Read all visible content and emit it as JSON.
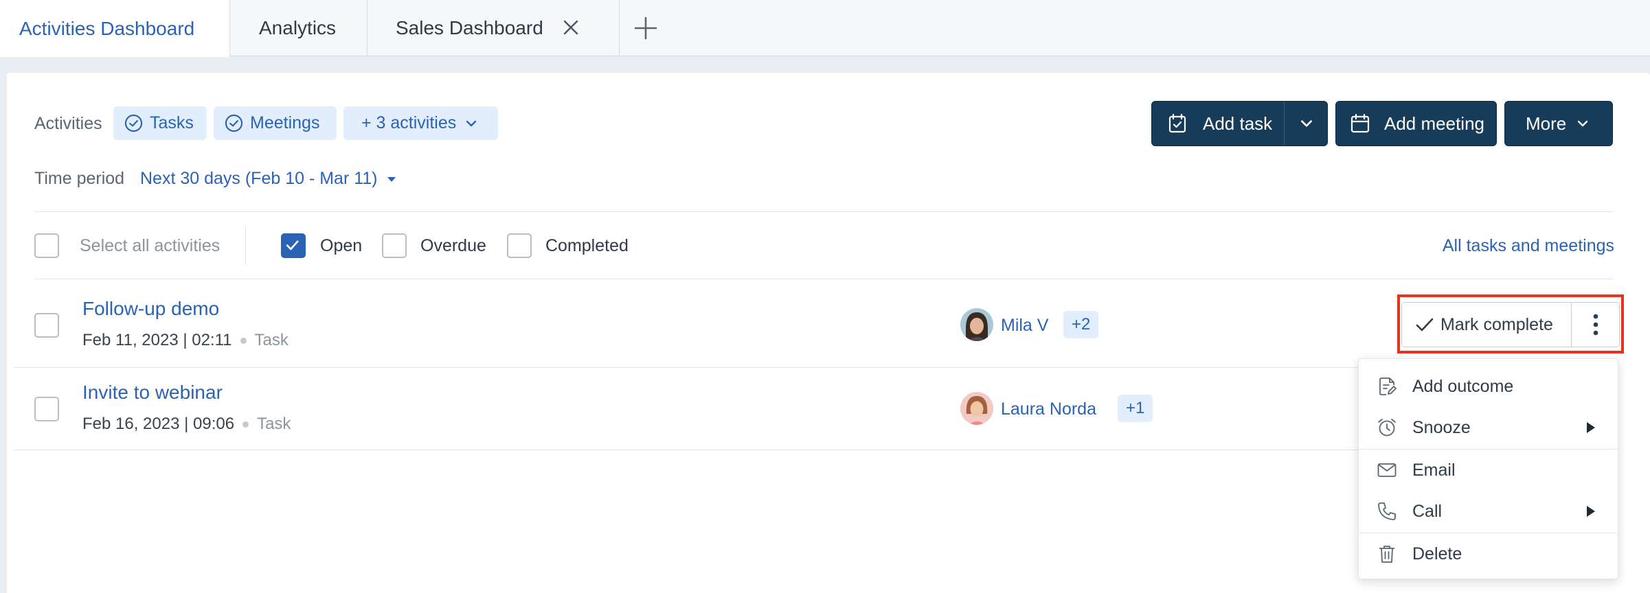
{
  "tabs": [
    {
      "label": "Activities Dashboard"
    },
    {
      "label": "Analytics"
    },
    {
      "label": "Sales Dashboard"
    }
  ],
  "filters": {
    "activities_label": "Activities",
    "chip_tasks": "Tasks",
    "chip_meetings": "Meetings",
    "chip_more": "+ 3 activities",
    "time_period_label": "Time period",
    "time_period_value": "Next 30 days (Feb 10 - Mar 11)"
  },
  "toolbar": {
    "add_task": "Add task",
    "add_meeting": "Add meeting",
    "more": "More"
  },
  "status_filters": {
    "select_all": "Select all activities",
    "open": "Open",
    "overdue": "Overdue",
    "completed": "Completed",
    "all_link": "All tasks and meetings"
  },
  "activities": [
    {
      "title": "Follow-up demo",
      "datetime": "Feb 11, 2023 | 02:11",
      "type": "Task",
      "person": "Mila V",
      "extra": "+2"
    },
    {
      "title": "Invite to webinar",
      "datetime": "Feb 16, 2023 | 09:06",
      "type": "Task",
      "person": "Laura Norda",
      "extra": "+1"
    }
  ],
  "row_actions": {
    "mark_complete": "Mark complete"
  },
  "menu": {
    "add_outcome": "Add outcome",
    "snooze": "Snooze",
    "email": "Email",
    "call": "Call",
    "delete": "Delete"
  },
  "colors": {
    "accent": "#2b63b4",
    "dark_button": "#173c59",
    "highlight": "#e8321e"
  }
}
